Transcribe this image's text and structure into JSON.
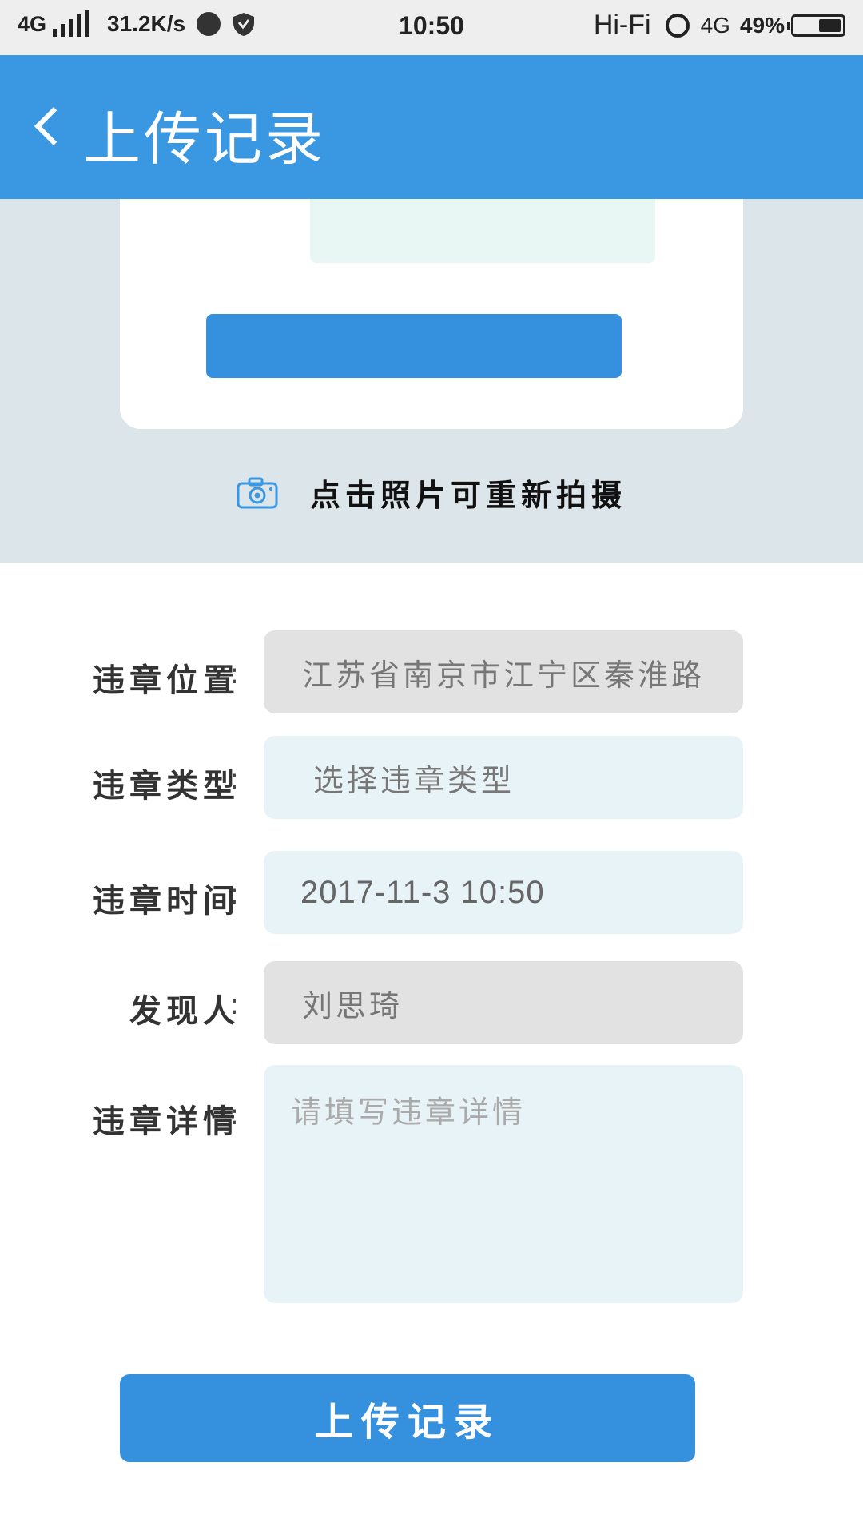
{
  "status_bar": {
    "network": "4G",
    "speed": "31.2K/s",
    "time": "10:50",
    "hifi": "Hi-Fi",
    "network_right": "4G",
    "battery_percent": "49%",
    "battery_level": 0.49
  },
  "header": {
    "title": "上传记录"
  },
  "photo": {
    "retake_hint": "点击照片可重新拍摄"
  },
  "form": {
    "location": {
      "label": "违章位置",
      "colon": ":",
      "value": "江苏省南京市江宁区秦淮路"
    },
    "type": {
      "label": "违章类型",
      "colon": ":",
      "value": "选择违章类型"
    },
    "time": {
      "label": "违章时间",
      "colon": ":",
      "value": "2017-11-3 10:50"
    },
    "finder": {
      "label": "发现人",
      "colon": ":",
      "value": "刘思琦"
    },
    "details": {
      "label": "违章详情",
      "colon": ":",
      "placeholder": "请填写违章详情"
    }
  },
  "submit": {
    "label": "上传记录"
  },
  "colors": {
    "accent": "#3a97e2",
    "photo_bg": "#dbe5ea",
    "field_gray": "#e2e2e2",
    "field_blue": "#e8f3f8"
  }
}
